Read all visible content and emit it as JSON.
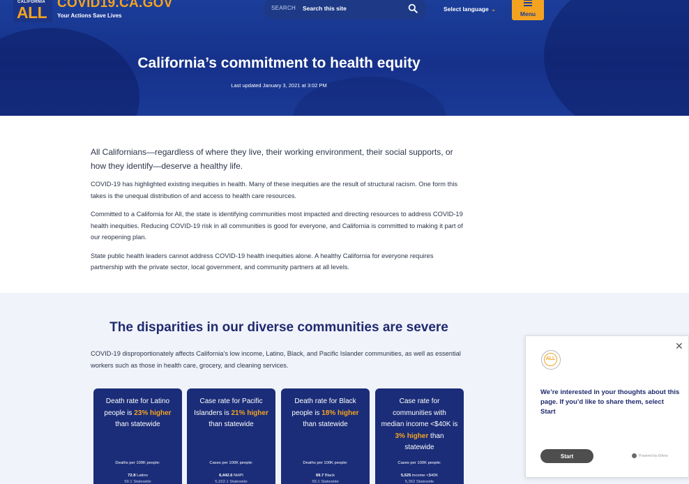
{
  "header": {
    "logo_small": "CALIFORNIA",
    "logo_big": "ALL",
    "site_title": "COVID19.CA.GOV",
    "tagline": "Your Actions Save Lives",
    "search": {
      "label": "SEARCH",
      "placeholder": "Search this site",
      "icon": "search-icon"
    },
    "language_label": "Select language",
    "menu_label": "Menu"
  },
  "hero": {
    "title": "California’s commitment to health equity",
    "last_updated": "Last updated January 3, 2021 at 3:02 PM"
  },
  "intro": {
    "lead": "All Californians—regardless of where they live, their working environment, their social supports, or how they identify—deserve a healthy life.",
    "paragraphs": [
      "COVID-19 has highlighted existing inequities in health. Many of these inequities are the result of structural racism. One form this takes is the unequal distribution of and access to health care resources.",
      "Committed to a California for All, the state is identifying communities most impacted and directing resources to address COVID-19 health inequities. Reducing COVID-19 risk in all communities is good for everyone, and California is committed to making it part of our reopening plan.",
      "State public health leaders cannot address COVID-19 health inequities alone. A healthy California for everyone requires partnership with the private sector, local government, and community partners at all levels."
    ]
  },
  "disparities": {
    "title": "The disparities in our diverse communities are severe",
    "text": "COVID-19 disproportionately affects California’s low income, Latino, Black, and Pacific Islander communities, as well as essential workers such as those in health care, grocery, and cleaning services.",
    "cards": [
      {
        "pre": "Death rate for Latino people is ",
        "highlight": "23% higher",
        "post": " than statewide",
        "sub": "Deaths per 100K people:",
        "value": "72.8",
        "value_label": "Latino",
        "row2": "59.1 Statewide"
      },
      {
        "pre": "Case rate for Pacific Islanders is ",
        "highlight": "21% higher",
        "post": " than statewide",
        "sub": "Cases per 100K people:",
        "value": "6,442.6",
        "value_label": "NHPI",
        "row2": "5,322.1 Statewide"
      },
      {
        "pre": "Death rate for Black people is ",
        "highlight": "18% higher",
        "post": " than statewide",
        "sub": "Deaths per 100K people:",
        "value": "69.7",
        "value_label": "Black",
        "row2": "59.1 Statewide"
      },
      {
        "pre": "Case rate for communities with median income <$40K is ",
        "highlight": "3% higher",
        "post": " than statewide",
        "sub": "Cases per 100K people:",
        "value": "5,525",
        "value_label": "income <$40K",
        "row2": "5,362 Statewide"
      }
    ]
  },
  "feedback": {
    "message": "We’re interested in your thoughts about this page. If you’d like to share them, select Start",
    "start_label": "Start",
    "powered_by": "Powered by Ethnio",
    "close_icon": "close-icon"
  },
  "colors": {
    "brand_blue": "#1b3e9a",
    "navy": "#1b2d78",
    "accent_orange": "#f4a321",
    "section_bg": "#f1f3fb"
  }
}
